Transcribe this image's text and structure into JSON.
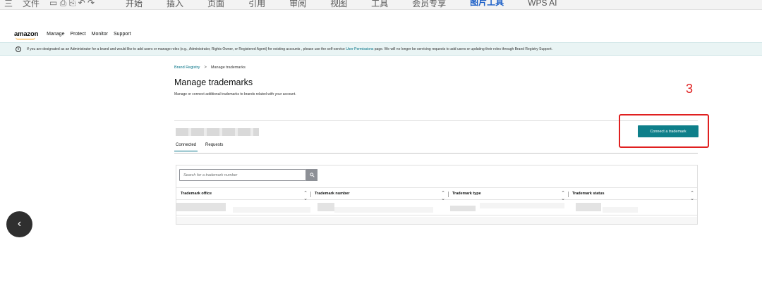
{
  "wps_toolbar": {
    "left_items": [
      "三",
      "文件",
      "▾"
    ],
    "tabs": [
      "开始",
      "插入",
      "页面",
      "引用",
      "审阅",
      "视图",
      "工具",
      "会员专享",
      "图片工具",
      "WPS AI"
    ],
    "active_tab": "图片工具"
  },
  "topnav": {
    "logo": "amazon",
    "links": [
      "Manage",
      "Protect",
      "Monitor",
      "Support"
    ]
  },
  "banner": {
    "icon": "info-icon",
    "text_before": "If you are designated as an Administrator for a brand and would like to add users or manage roles (e.g., Administrator, Rights Owner, or Registered Agent) for existing accounts , please use the self-service ",
    "link": "User Permissions",
    "text_after": " page. We will no longer be servicing requests to add users or updating their roles through Brand Registry Support."
  },
  "breadcrumb": {
    "root": "Brand Registry",
    "separator": ">",
    "current": "Manage trademarks"
  },
  "page": {
    "title": "Manage trademarks",
    "subtitle": "Manage or connect additional trademarks to brands related with your account."
  },
  "annotation": {
    "number": "3",
    "color": "#e02020"
  },
  "connect_button": {
    "label": "Connect a trademark",
    "color": "#0e7f8a"
  },
  "tabs": [
    {
      "label": "Connected",
      "active": true
    },
    {
      "label": "Requests",
      "active": false
    }
  ],
  "search": {
    "placeholder": "Search for a trademark number",
    "button_icon": "search-icon"
  },
  "table": {
    "columns": [
      "Trademark office",
      "Trademark number",
      "Trademark type",
      "Trademark status"
    ],
    "sort_icon": "sort-icon"
  },
  "back_button": {
    "icon": "chevron-left-icon"
  }
}
